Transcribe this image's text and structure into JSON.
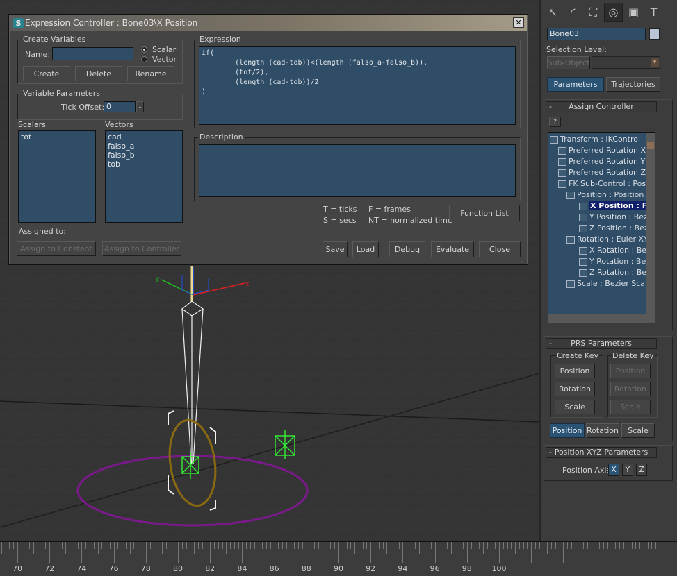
{
  "dialog": {
    "title": "Expression Controller : Bone03\\X Position",
    "close_glyph": "✕",
    "create_variables": {
      "label": "Create Variables",
      "name_label": "Name:",
      "name_value": "",
      "radio_scalar": "Scalar",
      "radio_vector": "Vector",
      "selected_type": "Scalar",
      "create_btn": "Create",
      "delete_btn": "Delete",
      "rename_btn": "Rename"
    },
    "variable_parameters": {
      "label": "Variable Parameters",
      "tick_offset_label": "Tick Offset:",
      "tick_offset_value": "0"
    },
    "scalars": {
      "label": "Scalars",
      "items": [
        "tot"
      ]
    },
    "vectors": {
      "label": "Vectors",
      "items": [
        "cad",
        "falso_a",
        "falso_b",
        "tob"
      ]
    },
    "assigned_to_label": "Assigned to:",
    "assign_constant_btn": "Assign to Constant",
    "assign_controller_btn": "Assign to Controller",
    "expression": {
      "label": "Expression",
      "text": "if(\n        (length (cad-tob))<(length (falso_a-falso_b)),\n        (tot/2),\n        (length (cad-tob))/2\n)"
    },
    "description": {
      "label": "Description",
      "text": ""
    },
    "legend": {
      "ticks": "T = ticks",
      "secs": "S = secs",
      "frames": "F = frames",
      "normalized": "NT = normalized time"
    },
    "function_list_btn": "Function List",
    "save_btn": "Save",
    "load_btn": "Load",
    "debug_btn": "Debug",
    "evaluate_btn": "Evaluate",
    "close_btn": "Close"
  },
  "command_panel": {
    "tab_icons": [
      "create-icon",
      "modify-icon",
      "hierarchy-icon",
      "motion-icon",
      "display-icon",
      "utilities-icon"
    ],
    "tab_glyphs": [
      "↖",
      "◜",
      "⛶",
      "◎",
      "▣",
      "T"
    ],
    "object_name": "Bone03",
    "object_color": "#b9c4d7",
    "selection_level_label": "Selection Level:",
    "sub_object_btn": "Sub-Object",
    "parameters_btn": "Parameters",
    "trajectories_btn": "Trajectories",
    "assign_controller": {
      "header": "Assign Controller",
      "collapse": "-",
      "assign_icon": "?",
      "tree": [
        {
          "text": "Transform : IKControl",
          "level": 0
        },
        {
          "text": "Preferred Rotation X",
          "level": 1
        },
        {
          "text": "Preferred Rotation Y",
          "level": 1
        },
        {
          "text": "Preferred Rotation Z",
          "level": 1
        },
        {
          "text": "FK Sub-Control : Positio",
          "level": 1
        },
        {
          "text": "Position : Position X",
          "level": 2
        },
        {
          "text": "X Position : F",
          "level": 3,
          "selected": true
        },
        {
          "text": "Y Position : Bezi",
          "level": 3
        },
        {
          "text": "Z Position : Bezi",
          "level": 3
        },
        {
          "text": "Rotation : Euler XYZ",
          "level": 2
        },
        {
          "text": "X Rotation : Bez",
          "level": 3
        },
        {
          "text": "Y Rotation : Bez",
          "level": 3
        },
        {
          "text": "Z Rotation : Bez",
          "level": 3
        },
        {
          "text": "Scale : Bezier Scale",
          "level": 2
        }
      ]
    },
    "prs": {
      "header": "PRS Parameters",
      "collapse": "-",
      "create_key_label": "Create Key",
      "delete_key_label": "Delete Key",
      "create_position": "Position",
      "create_rotation": "Rotation",
      "create_scale": "Scale",
      "delete_position": "Position",
      "delete_rotation": "Rotation",
      "delete_scale": "Scale",
      "tab_position": "Position",
      "tab_rotation": "Rotation",
      "tab_scale": "Scale"
    },
    "xyz": {
      "header": "Position XYZ Parameters",
      "collapse": "-",
      "axis_label": "Position Axis:",
      "x": "X",
      "y": "Y",
      "z": "Z",
      "selected": "X"
    }
  },
  "timeline": {
    "labels": [
      "70",
      "72",
      "74",
      "76",
      "78",
      "80",
      "82",
      "84",
      "86",
      "88",
      "90",
      "92",
      "94",
      "96",
      "98",
      "100"
    ]
  },
  "viewport": {
    "gizmo_axes": [
      "x",
      "y"
    ],
    "colors": {
      "bone": "#f0f0f0",
      "helper": "#33ff33",
      "ring_gold": "#8a6a10",
      "ring_purple": "#7a1a8a"
    }
  }
}
